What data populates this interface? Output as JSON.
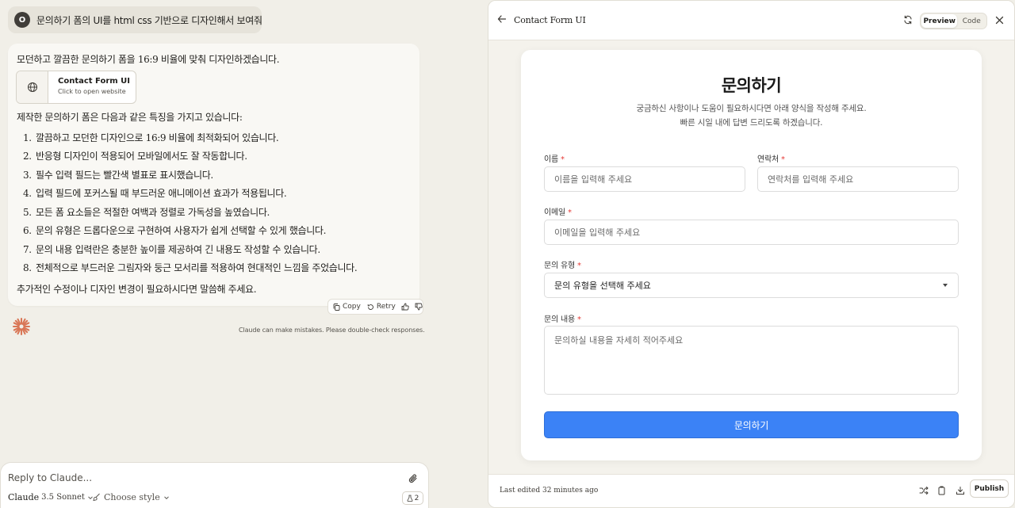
{
  "user_message": {
    "avatar_initial": "O",
    "text": "문의하기 폼의 UI를 html css 기반으로 디자인해서 보여줘"
  },
  "assistant": {
    "intro": "모던하고 깔끔한 문의하기 폼을 16:9 비율에 맞춰 디자인하겠습니다.",
    "artifact": {
      "title": "Contact Form UI",
      "subtitle": "Click to open website",
      "icon": "globe-icon"
    },
    "features_intro": "제작한 문의하기 폼은 다음과 같은 특징을 가지고 있습니다:",
    "features": [
      "깔끔하고 모던한 디자인으로 16:9 비율에 최적화되어 있습니다.",
      "반응형 디자인이 적용되어 모바일에서도 잘 작동합니다.",
      "필수 입력 필드는 빨간색 별표로 표시했습니다.",
      "입력 필드에 포커스될 때 부드러운 애니메이션 효과가 적용됩니다.",
      "모든 폼 요소들은 적절한 여백과 정렬로 가독성을 높였습니다.",
      "문의 유형은 드롭다운으로 구현하여 사용자가 쉽게 선택할 수 있게 했습니다.",
      "문의 내용 입력란은 충분한 높이를 제공하여 긴 내용도 작성할 수 있습니다.",
      "전체적으로 부드러운 그림자와 둥근 모서리를 적용하여 현대적인 느낌을 주었습니다."
    ],
    "outro": "추가적인 수정이나 디자인 변경이 필요하시다면 말씀해 주세요."
  },
  "actions": {
    "copy": "Copy",
    "retry": "Retry"
  },
  "disclaimer": "Claude can make mistakes. Please double-check responses.",
  "composer": {
    "placeholder": "Reply to Claude...",
    "model_name": "Claude",
    "model_version": "3.5 Sonnet",
    "style_label": "Choose style",
    "count": "2"
  },
  "artifact_panel": {
    "title": "Contact Form UI",
    "toggle": {
      "preview": "Preview",
      "code": "Code",
      "active": "preview"
    },
    "footer": {
      "last_edited": "Last edited 32 minutes ago",
      "publish": "Publish"
    }
  },
  "contact_form": {
    "title": "문의하기",
    "description_1": "궁금하신 사항이나 도움이 필요하시다면 아래 양식을 작성해 주세요.",
    "description_2": "빠른 시일 내에 답변 드리도록 하겠습니다.",
    "required_mark": "*",
    "name": {
      "label": "이름",
      "placeholder": "이름을 입력해 주세요",
      "value": ""
    },
    "phone": {
      "label": "연락처",
      "placeholder": "연락처를 입력해 주세요",
      "value": ""
    },
    "email": {
      "label": "이메일",
      "placeholder": "이메일을 입력해 주세요",
      "value": ""
    },
    "inquiry_type": {
      "label": "문의 유형",
      "selected": "문의 유형을 선택해 주세요"
    },
    "content": {
      "label": "문의 내용",
      "placeholder": "문의하실 내용을 자세히 적어주세요",
      "value": ""
    },
    "submit": "문의하기"
  },
  "colors": {
    "page_background": "#f1efe8",
    "submit_button": "#3b82f6",
    "required": "#e53935",
    "claude_accent": "#d97757"
  }
}
